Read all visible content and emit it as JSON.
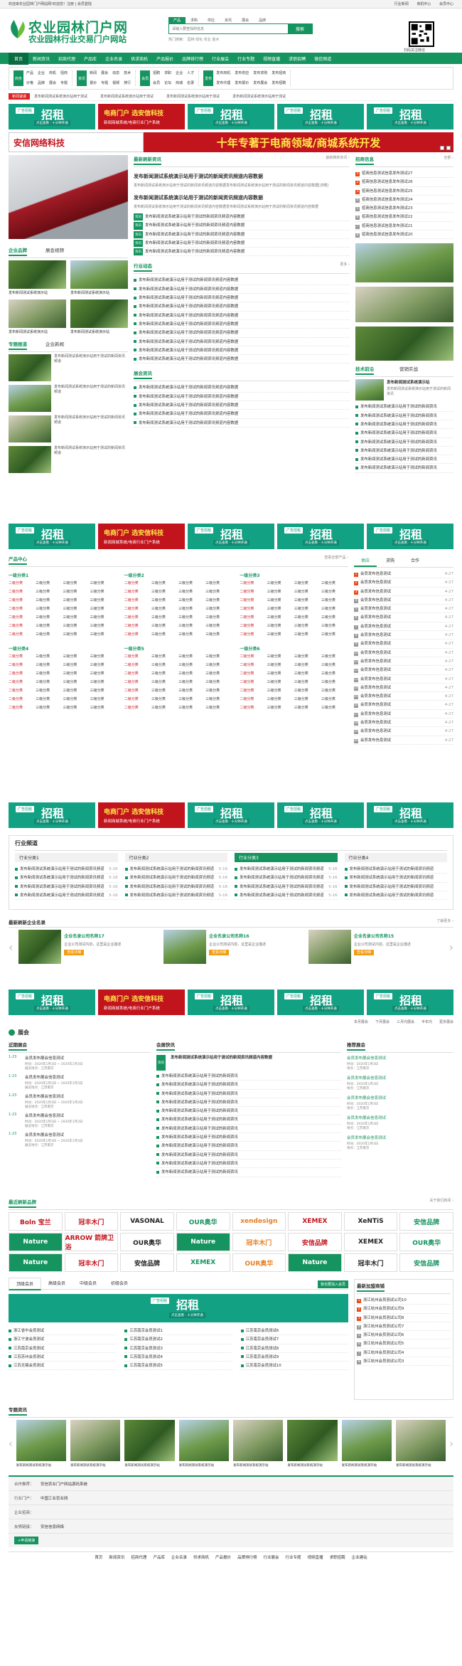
{
  "topbar": {
    "left": "欢迎来农业园林门户网站网!欢迎您！注册 | 会员登陆",
    "links": [
      "行业新闻",
      "商机中心",
      "会员中心"
    ]
  },
  "header": {
    "logo_main": "农业园林门户网",
    "logo_sub": "农业园林行业交易门户网站",
    "search_tabs": [
      "产品",
      "求购",
      "供应",
      "资讯",
      "展会",
      "品牌"
    ],
    "search_placeholder": "请输入要查找的信息",
    "search_button": "搜索",
    "hot_words": "热门搜索： 园林 绿化 农业 苗木",
    "qr_label": "扫码关注微信"
  },
  "nav": [
    "首页",
    "新闻资讯",
    "招商代理",
    "产品库",
    "企业名录",
    "供求商机",
    "产品报价",
    "品牌排行榜",
    "行业展会",
    "行业专题",
    "视频直播",
    "求职招聘",
    "微信频道"
  ],
  "subnav": [
    {
      "label": "商务",
      "items": [
        "产品",
        "企业",
        "商机",
        "招商",
        "价格",
        "品牌",
        "展会",
        "专题"
      ]
    },
    {
      "label": "资讯",
      "items": [
        "新闻",
        "展会",
        "动态",
        "技术",
        "报价",
        "专题",
        "视频",
        "排行"
      ]
    },
    {
      "label": "会员",
      "items": [
        "招聘",
        "求职",
        "企业",
        "人才",
        "会员",
        "论坛",
        "商城",
        "名录"
      ]
    },
    {
      "label": "发布",
      "items": [
        "发布商机",
        "发布供应",
        "发布求购",
        "发布招商",
        "发布代理",
        "发布报价",
        "发布展会",
        "发布招聘"
      ]
    }
  ],
  "notice": {
    "label": "新闻速递",
    "items": [
      "发布新闻测试系统演示站用于测试",
      "发布新闻测试系统演示站用于测试",
      "发布新闻测试系统演示站用于测试",
      "发布新闻测试系统演示站用于测试",
      "发布新闻测试系统演示站用于测试"
    ]
  },
  "ad": {
    "label": "广告招租",
    "big": "招租",
    "sub": "点击查看 · 十分钟开通",
    "red_l1": "电商门户 选安信科技",
    "red_l2": "新闻商城系统/电商行业门户系统"
  },
  "banner": {
    "left": "安信网络科技",
    "right": "十年专著于电商领域/商城系统开发"
  },
  "news": {
    "latest_title": "最新刷新资讯",
    "latest_more": "最新刷新资讯 ›",
    "headline1": "发布新闻测试系统演示站用于测试的新闻资讯频道内容数据",
    "headline1_desc": "发布新闻测试系统演示站用于测试的新闻资讯频道内容数据发布新闻测试系统演示站用于测试的新闻资讯频道内容数据[详细]",
    "headline2": "发布新闻测试系统演示站用于测试的新闻资讯频道内容数据",
    "headline2_desc": "发布新闻测试系统演示站用于测试的新闻资讯频道内容数据发布新闻测试系统演示站用于测试的新闻资讯频道内容数据",
    "tagged": [
      "发布新闻测试系统演示站用于测试的新闻资讯频道内容数据",
      "发布新闻测试系统演示站用于测试的新闻资讯频道内容数据",
      "发布新闻测试系统演示站用于测试的新闻资讯频道内容数据",
      "发布新闻测试系统演示站用于测试的新闻资讯频道内容数据",
      "发布新闻测试系统演示站用于测试的新闻资讯频道内容数据"
    ],
    "tag": "资讯",
    "industry_title": "行业动态",
    "industry": [
      "发布新闻测试系统演示站用于测试的新闻资讯频道内容数据",
      "发布新闻测试系统演示站用于测试的新闻资讯频道内容数据",
      "发布新闻测试系统演示站用于测试的新闻资讯频道内容数据",
      "发布新闻测试系统演示站用于测试的新闻资讯频道内容数据",
      "发布新闻测试系统演示站用于测试的新闻资讯频道内容数据",
      "发布新闻测试系统演示站用于测试的新闻资讯频道内容数据",
      "发布新闻测试系统演示站用于测试的新闻资讯频道内容数据",
      "发布新闻测试系统演示站用于测试的新闻资讯频道内容数据",
      "发布新闻测试系统演示站用于测试的新闻资讯频道内容数据",
      "发布新闻测试系统演示站用于测试的新闻资讯频道内容数据"
    ],
    "expo_title": "展会资讯",
    "expo": [
      "发布新闻测试系统演示站用于测试的新闻资讯频道内容数据",
      "发布新闻测试系统演示站用于测试的新闻资讯频道内容数据",
      "发布新闻测试系统演示站用于测试的新闻资讯频道内容数据",
      "发布新闻测试系统演示站用于测试的新闻资讯频道内容数据",
      "发布新闻测试系统演示站用于测试的新闻资讯频道内容数据"
    ],
    "more": "更多 ›"
  },
  "left": {
    "tab1": "企业品牌",
    "tab2": "展会视频",
    "photos": [
      "发布新闻测试系统演示站",
      "发布新闻测试系统演示站",
      "发布新闻测试系统演示站",
      "发布新闻测试系统演示站"
    ],
    "tab3": "专题报道",
    "tab4": "企业新闻",
    "topics": [
      "发布新闻测试系统演示站用于测试的新闻资讯频道",
      "发布新闻测试系统演示站用于测试的新闻资讯频道",
      "发布新闻测试系统演示站用于测试的新闻资讯频道",
      "发布新闻测试系统演示站用于测试的新闻资讯频道"
    ]
  },
  "right": {
    "title": "招商信息",
    "more": "全部 ›",
    "items": [
      "招商信息测试信息发布测试27",
      "招商信息测试信息发布测试26",
      "招商信息测试信息发布测试25",
      "招商信息测试信息发布测试24",
      "招商信息测试信息发布测试23",
      "招商信息测试信息发布测试22",
      "招商信息测试信息发布测试21",
      "招商信息测试信息发布测试20"
    ],
    "tab1": "技术前沿",
    "tab2": "营销实战",
    "tech_title": "发布新闻测试系统演示站",
    "tech_desc": "发布新闻测试系统演示站用于测试的新闻资讯",
    "tech_list": [
      "发布新闻测试系统演示站用于测试的新闻资讯",
      "发布新闻测试系统演示站用于测试的新闻资讯",
      "发布新闻测试系统演示站用于测试的新闻资讯",
      "发布新闻测试系统演示站用于测试的新闻资讯",
      "发布新闻测试系统演示站用于测试的新闻资讯",
      "发布新闻测试系统演示站用于测试的新闻资讯",
      "发布新闻测试系统演示站用于测试的新闻资讯",
      "发布新闻测试系统演示站用于测试的新闻资讯"
    ]
  },
  "products": {
    "title": "产品中心",
    "more": "查看全部产品 ›",
    "cats": [
      "一级分类1",
      "一级分类2",
      "一级分类3",
      "一级分类4",
      "一级分类5",
      "一级分类6"
    ],
    "hot": "二级分类",
    "normal": "三级分类",
    "tabs": [
      "供应",
      "求购",
      "合作"
    ],
    "supply": [
      "会员发布信息测试",
      "会员发布信息测试",
      "会员发布信息测试",
      "会员发布信息测试",
      "会员发布信息测试",
      "会员发布信息测试",
      "会员发布信息测试",
      "会员发布信息测试",
      "会员发布信息测试",
      "会员发布信息测试",
      "会员发布信息测试",
      "会员发布信息测试",
      "会员发布信息测试",
      "会员发布信息测试",
      "会员发布信息测试",
      "会员发布信息测试",
      "会员发布信息测试",
      "会员发布信息测试",
      "会员发布信息测试",
      "会员发布信息测试"
    ],
    "date": "4-27"
  },
  "channel": {
    "title": "行业频道",
    "sub": [
      "行业分类1",
      "行业分类2",
      "行业分类3",
      "行业分类4"
    ],
    "items": [
      "发布新闻测试系统演示站用于测试的新闻资讯频道",
      "发布新闻测试系统演示站用于测试的新闻资讯频道",
      "发布新闻测试系统演示站用于测试的新闻资讯频道",
      "发布新闻测试系统演示站用于测试的新闻资讯频道"
    ],
    "date": "5-16"
  },
  "companies": {
    "title": "最新刷新企业名录",
    "more": "了解更多 ›",
    "cards": [
      {
        "name": "企业名录公司名称17",
        "desc": "企业公司测试内容，这里是企业描述",
        "btn": "查看详细"
      },
      {
        "name": "企业名录公司名称16",
        "desc": "企业公司测试内容，这里是企业描述",
        "btn": "查看详细"
      },
      {
        "name": "企业名录公司名称15",
        "desc": "企业公司测试内容，这里是企业描述",
        "btn": "查看详细"
      }
    ]
  },
  "expo_bar": [
    "本月展会",
    "下月展会",
    "三月内展会",
    "半年内",
    "更多展会"
  ],
  "expo": {
    "title": "展会",
    "col1": "近期展会",
    "col2": "会展快讯",
    "col3": "推荐展会",
    "items": [
      {
        "d": "1-23",
        "t": "会员发布展会信息测试",
        "i1": "时间：2020年1月3日 ~ 2020年1月3日",
        "i2": "展览地点：江苏南京"
      },
      {
        "d": "1-23",
        "t": "会员发布展会信息测试",
        "i1": "时间：2020年1月3日 ~ 2020年1月3日",
        "i2": "展览地点：江苏南京"
      },
      {
        "d": "1-23",
        "t": "会员发布展会信息测试",
        "i1": "时间：2020年1月3日 ~ 2020年1月3日",
        "i2": "展览地点：江苏南京"
      },
      {
        "d": "1-23",
        "t": "会员发布展会信息测试",
        "i1": "时间：2020年1月3日 ~ 2020年1月3日",
        "i2": "展览地点：江苏南京"
      },
      {
        "d": "1-23",
        "t": "会员发布展会信息测试",
        "i1": "时间：2020年1月3日 ~ 2020年1月3日",
        "i2": "展览地点：江苏南京"
      }
    ],
    "headline": "发布新闻测试系统演示站用于测试的新闻资讯频道内容数据",
    "news": [
      "发布新闻测试系统演示站用于测试的新闻资讯",
      "发布新闻测试系统演示站用于测试的新闻资讯",
      "发布新闻测试系统演示站用于测试的新闻资讯",
      "发布新闻测试系统演示站用于测试的新闻资讯",
      "发布新闻测试系统演示站用于测试的新闻资讯",
      "发布新闻测试系统演示站用于测试的新闻资讯",
      "发布新闻测试系统演示站用于测试的新闻资讯",
      "发布新闻测试系统演示站用于测试的新闻资讯",
      "发布新闻测试系统演示站用于测试的新闻资讯",
      "发布新闻测试系统演示站用于测试的新闻资讯",
      "发布新闻测试系统演示站用于测试的新闻资讯",
      "发布新闻测试系统演示站用于测试的新闻资讯"
    ],
    "rec": [
      {
        "t": "会员发布展会信息测试",
        "a": "时间：2020年1月3日",
        "b": "地点：江苏南京"
      },
      {
        "t": "会员发布展会信息测试",
        "a": "时间：2020年1月3日",
        "b": "地点：江苏南京"
      },
      {
        "t": "会员发布展会信息测试",
        "a": "时间：2020年1月3日",
        "b": "地点：江苏南京"
      },
      {
        "t": "会员发布展会信息测试",
        "a": "时间：2020年1月3日",
        "b": "地点：江苏南京"
      },
      {
        "t": "会员发布展会信息测试",
        "a": "时间：2020年1月3日",
        "b": "地点：江苏南京"
      }
    ]
  },
  "brands": {
    "title": "最近刷新品牌",
    "more": "关于我们新闻 ›",
    "logos": [
      "Boln 宝兰",
      "冠丰木门",
      "VASONAL",
      "OUR奥华",
      "xendesign",
      "XEMEX",
      "XeNTiS",
      "安信品牌",
      "Nature",
      "ARROW 箭牌卫浴",
      "OUR奥华",
      "Nature",
      "冠丰木门",
      "安信品牌",
      "XEMEX",
      "OUR奥华",
      "Nature",
      "冠丰木门",
      "安信品牌",
      "XEMEX",
      "OUR奥华",
      "Nature",
      "冠丰木门",
      "安信品牌"
    ]
  },
  "members": {
    "tabs": [
      "顶级会员",
      "高级会员",
      "中级会员",
      "初级会员"
    ],
    "btn": "我也要加入会员",
    "cols": [
      [
        "浙江省中会员测试",
        "浙江宁波会员测试",
        "江苏南京会员测试",
        "江苏苏州会员测试",
        "江苏无锡会员测试"
      ],
      [
        "江苏南京会员测试1",
        "江苏南京会员测试2",
        "江苏南京会员测试3",
        "江苏南京会员测试4",
        "江苏南京会员测试5"
      ],
      [
        "江苏南京会员测试6",
        "江苏南京会员测试7",
        "江苏南京会员测试8",
        "江苏南京会员测试9",
        "江苏南京会员测试10"
      ]
    ],
    "reg_title": "最新加盟商铺",
    "reg": [
      "浙江杭州会员测试公司10",
      "浙江杭州会员测试公司9",
      "浙江杭州会员测试公司8",
      "浙江杭州会员测试公司7",
      "浙江杭州会员测试公司6",
      "浙江杭州会员测试公司5",
      "浙江杭州会员测试公司4",
      "浙江杭州会员测试公司3"
    ]
  },
  "topics": {
    "title": "专题资讯",
    "items": [
      "发布新闻测试系统演示站",
      "发布新闻测试系统演示站",
      "发布新闻测试系统演示站",
      "发布新闻测试系统演示站",
      "发布新闻测试系统演示站",
      "发布新闻测试系统演示站",
      "发布新闻测试系统演示站",
      "发布新闻测试系统演示站"
    ]
  },
  "footer": {
    "rows": [
      {
        "l": "合作推荐：",
        "v": "安信农业门户网站源码系统"
      },
      {
        "l": "行业门户：",
        "v": "中国工业农业网"
      },
      {
        "l": "企业招商：",
        "v": ""
      },
      {
        "l": "友情链接：",
        "v": "安信信息网络"
      }
    ],
    "apply": "+申请链接"
  },
  "bottom_nav": [
    "首页",
    "新闻资讯",
    "招商代理",
    "产品库",
    "企业名录",
    "供求商机",
    "产品报价",
    "品牌排行榜",
    "行业展会",
    "行业专题",
    "视频直播",
    "求职招聘",
    "企业建站"
  ]
}
